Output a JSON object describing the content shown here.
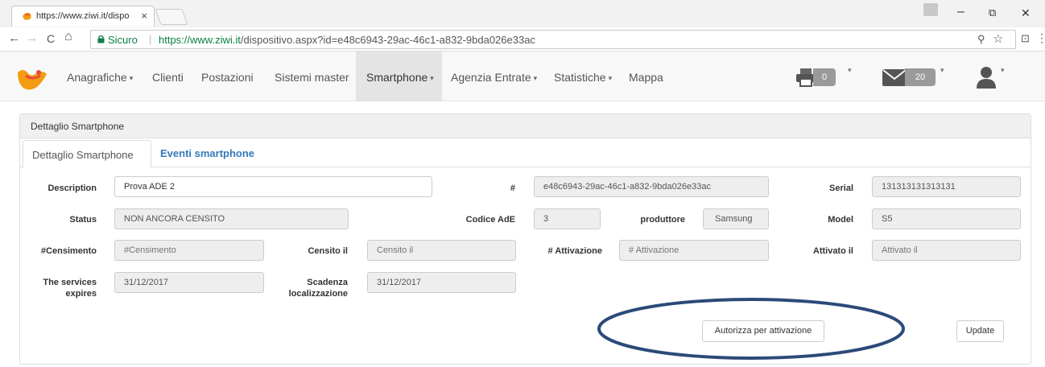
{
  "browser": {
    "tab_title": "https://www.ziwi.it/dispo",
    "tab_close": "×",
    "address": {
      "secure_label": "Sicuro",
      "separator": "|",
      "url_scheme_host": "https://www.ziwi.it",
      "url_path": "/dispositivo.aspx?id=e48c6943-29ac-46c1-a832-9bda026e33ac"
    },
    "window_controls": {
      "minimize": "–",
      "restore": "⧉",
      "close": "✕"
    },
    "nav_icons": {
      "back": "←",
      "forward": "→",
      "reload": "C",
      "home": "⌂",
      "zoom": "⚲",
      "star": "☆",
      "cast": "⊡",
      "menu": "⋮"
    }
  },
  "navbar": {
    "items": [
      {
        "label": "Anagrafiche",
        "dropdown": true
      },
      {
        "label": "Clienti",
        "dropdown": false
      },
      {
        "label": "Postazioni",
        "dropdown": false
      },
      {
        "label": "Sistemi master",
        "dropdown": false
      },
      {
        "label": "Smartphone",
        "dropdown": true,
        "active": true
      },
      {
        "label": "Agenzia Entrate",
        "dropdown": true
      },
      {
        "label": "Statistiche",
        "dropdown": true
      },
      {
        "label": "Mappa",
        "dropdown": false
      }
    ],
    "caret": "▾",
    "print_count": "0",
    "mail_count": "20"
  },
  "panel": {
    "heading": "Dettaglio Smartphone",
    "tabs": [
      {
        "label": "Dettaglio Smartphone",
        "active": true
      },
      {
        "label": "Eventi smartphone",
        "active": false
      }
    ],
    "fields": {
      "description": {
        "label": "Description",
        "value": "Prova ADE 2"
      },
      "hash": {
        "label": "#",
        "value": "e48c6943-29ac-46c1-a832-9bda026e33ac"
      },
      "serial": {
        "label": "Serial",
        "value": "131313131313131"
      },
      "status": {
        "label": "Status",
        "value": "NON ANCORA CENSITO"
      },
      "codice_ade": {
        "label": "Codice AdE",
        "value": "3"
      },
      "produttore": {
        "label": "produttore",
        "value": "Samsung"
      },
      "model": {
        "label": "Model",
        "value": "S5"
      },
      "censimento": {
        "label": "#Censimento",
        "placeholder": "#Censimento"
      },
      "censito_il": {
        "label": "Censito il",
        "placeholder": "Censito il"
      },
      "attivazione": {
        "label": "# Attivazione",
        "placeholder": "# Attivazione"
      },
      "attivato_il": {
        "label": "Attivato il",
        "placeholder": "Attivato il"
      },
      "services_expires": {
        "label_line1": "The services",
        "label_line2": "expires",
        "value": "31/12/2017"
      },
      "scadenza": {
        "label_line1": "Scadenza",
        "label_line2": "localizzazione",
        "value": "31/12/2017"
      }
    },
    "buttons": {
      "authorize": "Autorizza per attivazione",
      "update": "Update"
    }
  },
  "colors": {
    "link_blue": "#337ab7",
    "secure_green": "#0b8043",
    "annotation_ellipse": "#2b4a7a",
    "badge_gray": "#9a9a9a"
  }
}
